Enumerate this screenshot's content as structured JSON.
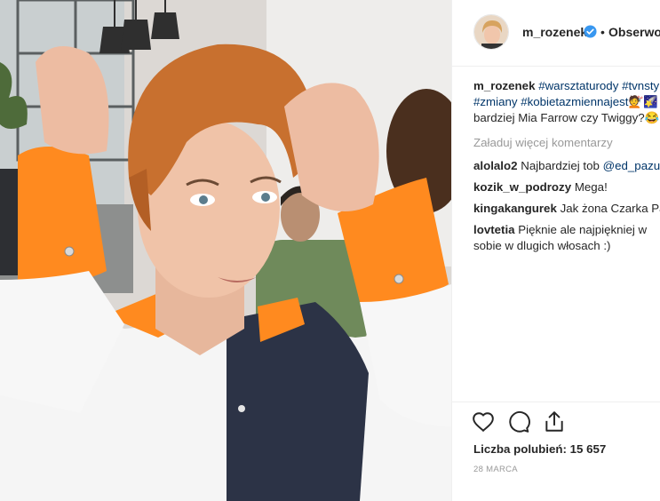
{
  "photo": {
    "alt": "post-photo"
  },
  "header": {
    "username": "m_rozenek",
    "separator": "•",
    "follow_label": "Obserwowanie"
  },
  "caption": {
    "username": "m_rozenek",
    "line1_tags": [
      "#warsztaturody",
      "#tvnstyle"
    ],
    "line2_tags": [
      "#zmiany",
      "#kobietazmiennajest"
    ],
    "line2_emoji": "💇🌠",
    "line3_text": "bardziej Mia Farrow czy Twiggy?😂"
  },
  "load_more_label": "Załaduj więcej komentarzy",
  "comments": [
    {
      "user": "alolalo2",
      "text": "Najbardziej tob",
      "mention": "@ed_pazura"
    },
    {
      "user": "kozik_w_podrozy",
      "text": "Mega!"
    },
    {
      "user": "kingakangurek",
      "text": "Jak żona Czarka Pazury"
    },
    {
      "user": "lovtetia",
      "text": "Pięknie ale najpiękniej w sobie w dlugich włosach :)"
    }
  ],
  "likes": {
    "label": "Liczba polubień:",
    "count": "15 657"
  },
  "date": "28 MARCA",
  "icons": {
    "like": "heart-icon",
    "comment": "comment-icon",
    "share": "share-icon"
  },
  "colors": {
    "link": "#003569",
    "verified": "#3897f0",
    "muted": "#999999"
  }
}
